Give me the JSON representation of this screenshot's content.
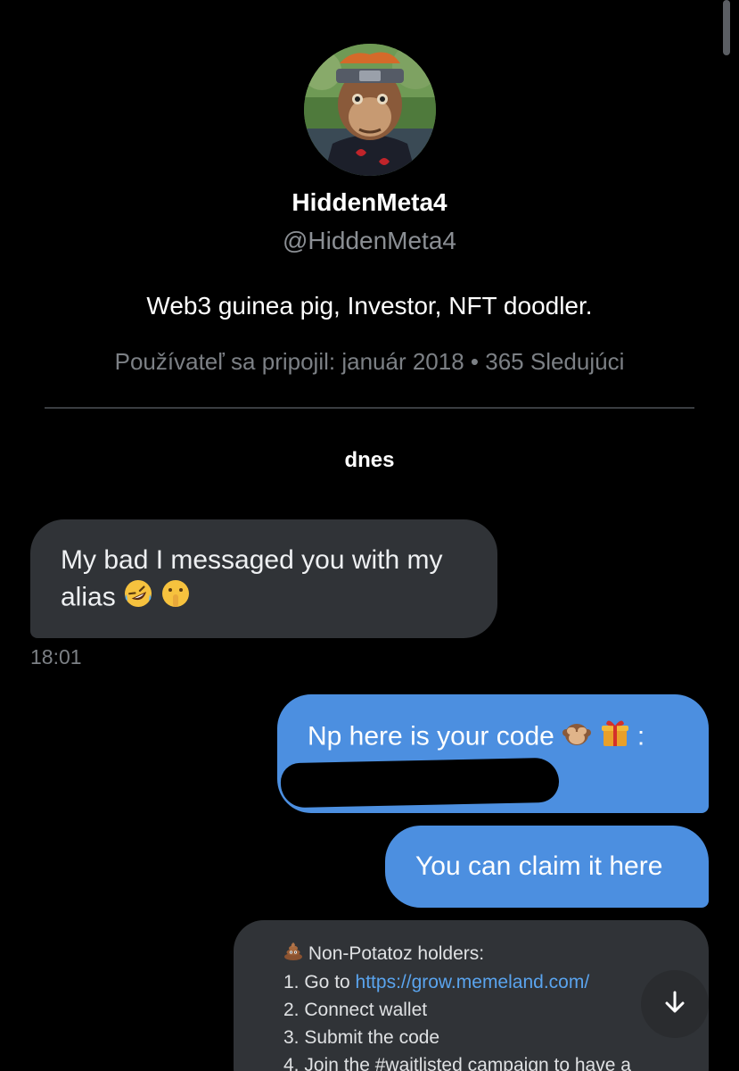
{
  "profile": {
    "display_name": "HiddenMeta4",
    "handle": "@HiddenMeta4",
    "bio": "Web3 guinea pig, Investor, NFT doodler.",
    "joined": "Používateľ sa pripojil: január 2018",
    "separator": "•",
    "followers": "365 Sledujúci"
  },
  "conversation": {
    "day_label": "dnes",
    "messages": [
      {
        "direction": "incoming",
        "line1": "My bad I messaged you with my",
        "line2": "alias",
        "emojis": [
          "rofl-emoji",
          "shushing-face-emoji"
        ],
        "time": "18:01"
      },
      {
        "direction": "outgoing",
        "text": "Np here is your code",
        "emojis": [
          "see-no-evil-monkey-emoji",
          "gift-emoji"
        ],
        "suffix": ":",
        "redacted": true
      },
      {
        "direction": "outgoing",
        "text": "You can claim it here"
      }
    ],
    "card": {
      "heading": "Non-Potatoz holders:",
      "heading_emoji": "pile-of-poo-emoji",
      "step1_prefix": "1. Go to ",
      "step1_link": "https://grow.memeland.com/",
      "step2": "2. Connect wallet",
      "step3": "3. Submit the code",
      "step4": "4. Join the #waitlisted campaign to have a"
    }
  },
  "colors": {
    "background": "#000000",
    "incoming_bubble": "#303337",
    "outgoing_bubble": "#4c8fe0",
    "link": "#5aa4ee",
    "muted_text": "#7c8085"
  },
  "icons": {
    "scroll_down": "arrow-down-icon"
  }
}
